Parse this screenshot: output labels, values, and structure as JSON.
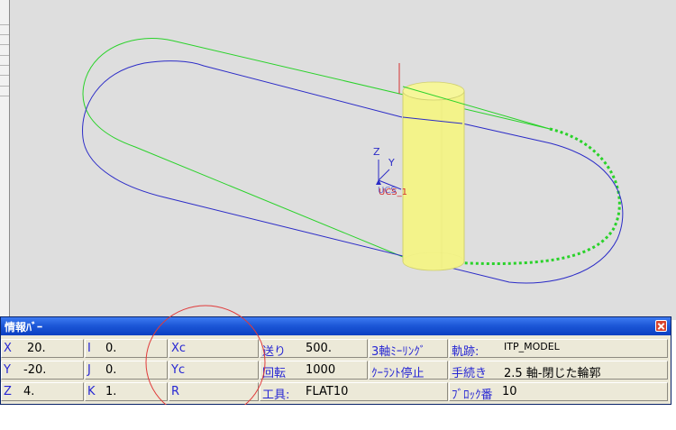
{
  "colors": {
    "viewport_bg": "#dedede",
    "green_path": "#2ad22a",
    "blue_path": "#2b2bc7",
    "cylinder": "#f3f38a",
    "marker_red": "#d43030",
    "annotation_circle": "#e03a3a",
    "titlebar": "#1d58d8"
  },
  "scene": {
    "axis_labels": {
      "z": "Z",
      "y": "Y"
    },
    "cs_label": "UCS_1"
  },
  "infobar": {
    "title": "情報ﾊﾞｰ",
    "coords": {
      "x_label": "X",
      "x_value": "20.",
      "y_label": "Y",
      "y_value": "-20.",
      "z_label": "Z",
      "z_value": "4."
    },
    "ijk": {
      "i_label": "I",
      "i_value": "0.",
      "j_label": "J",
      "j_value": "0.",
      "k_label": "K",
      "k_value": "1."
    },
    "arc": {
      "xc_label": "Xc",
      "yc_label": "Yc",
      "r_label": "R"
    },
    "feed": {
      "label": "送り",
      "value": "500."
    },
    "spindle": {
      "label": "回転",
      "value": "1000"
    },
    "tool": {
      "label": "工具:",
      "value": "FLAT10"
    },
    "status1": "3軸ﾐｰﾘﾝｸﾞ",
    "status2": "ｸｰﾗﾝﾄ停止",
    "trajectory": {
      "label": "軌跡:",
      "value": "ITP_MODEL"
    },
    "procedure": {
      "label": "手続き",
      "value": "2.5 軸-閉じた輪郭"
    },
    "block": {
      "label": "ﾌﾞﾛｯｸ番",
      "value": "10"
    }
  }
}
